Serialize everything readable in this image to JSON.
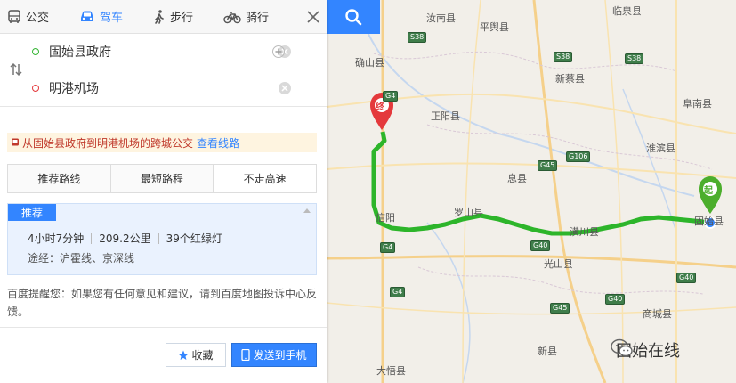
{
  "modes": {
    "transit": "公交",
    "drive": "驾车",
    "walk": "步行",
    "bike": "骑行"
  },
  "route": {
    "start": "固始县政府",
    "end": "明港机场"
  },
  "bus_tip": {
    "text": "从固始县政府到明港机场的跨城公交",
    "link": "查看线路"
  },
  "tabs": [
    "推荐路线",
    "最短路程",
    "不走高速"
  ],
  "card": {
    "badge": "推荐",
    "duration": "4小时7分钟",
    "distance": "209.2公里",
    "lights": "39个红绿灯",
    "via": "途经：沪霍线、京深线"
  },
  "reminder": "百度提醒您：如果您有任何意见和建议，请到百度地图投诉中心反馈。",
  "buttons": {
    "favorite": "收藏",
    "send": "发送到手机"
  },
  "map": {
    "cities": [
      "汝南县",
      "平舆县",
      "临泉县",
      "确山县",
      "新蔡县",
      "阜南县",
      "正阳县",
      "淮滨县",
      "息县",
      "信阳",
      "罗山县",
      "潢川县",
      "固始县",
      "光山县",
      "商城县",
      "新县",
      "大悟县"
    ],
    "highways": [
      "S38",
      "S38",
      "S38",
      "G4",
      "G4",
      "G45",
      "G106",
      "G4",
      "G40",
      "G40",
      "G40",
      "G45"
    ],
    "markers": {
      "start": "起",
      "end": "终"
    }
  },
  "watermark": "固始在线",
  "colors": {
    "accent": "#3385ff",
    "route": "#2db52a",
    "start_marker": "#4cae2c",
    "end_marker": "#e4393c"
  }
}
